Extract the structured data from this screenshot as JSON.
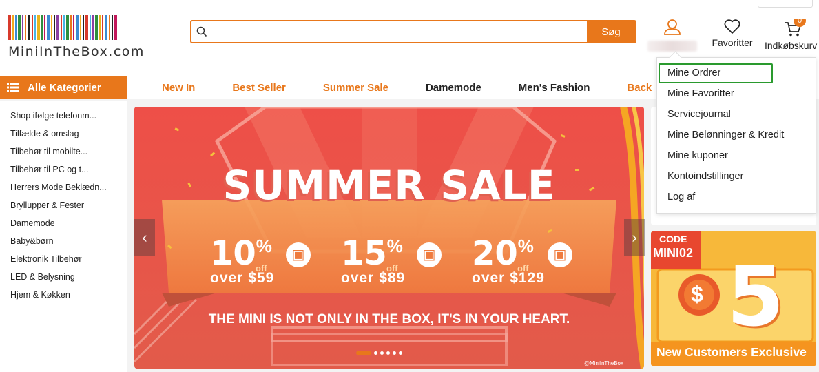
{
  "logo": {
    "text": "MiniInTheBox.com",
    "bar_colors": [
      "#d83a2c",
      "#f2a81d",
      "#3b8bd2",
      "#2e8e3e",
      "#8b3fa4",
      "#e8771b",
      "#222",
      "#d83a2c",
      "#47b3e3",
      "#e8b41b",
      "#2e8e3e",
      "#c2185b",
      "#3b8bd2",
      "#f2a81d",
      "#222",
      "#8b3fa4",
      "#d83a2c",
      "#47b3e3",
      "#2e8e3e",
      "#e8771b",
      "#c2185b",
      "#3b8bd2",
      "#f2a81d",
      "#222",
      "#d83a2c",
      "#47b3e3",
      "#8b3fa4",
      "#2e8e3e",
      "#e8b41b",
      "#d83a2c",
      "#3b8bd2",
      "#e8771b",
      "#222",
      "#c2185b"
    ]
  },
  "search": {
    "value": "",
    "button": "Søg"
  },
  "header": {
    "favorites": "Favoritter",
    "cart": "Indkøbskurv",
    "cart_count": "0"
  },
  "nav": {
    "all_categories": "Alle Kategorier",
    "links": [
      {
        "label": "New In",
        "color": "#e8771b"
      },
      {
        "label": "Best Seller",
        "color": "#e8771b"
      },
      {
        "label": "Summer Sale",
        "color": "#e8771b"
      },
      {
        "label": "Damemode",
        "color": "#222222"
      },
      {
        "label": "Men's Fashion",
        "color": "#222222"
      },
      {
        "label": "Back To",
        "color": "#e8771b"
      }
    ]
  },
  "sidebar": [
    "Shop ifølge telefonm...",
    "Tilfælde & omslag",
    "Tilbehør til mobilte...",
    "Tilbehør til PC og t...",
    "Herrers Mode Beklædn...",
    "Bryllupper & Fester",
    "Damemode",
    "Baby&børn",
    "Elektronik Tilbehør",
    "LED & Belysning",
    "Hjem & Køkken"
  ],
  "dropdown": [
    "Mine Ordrer",
    "Mine Favoritter",
    "Servicejournal",
    "Mine Belønninger & Kredit",
    "Mine kuponer",
    "Kontoindstillinger",
    "Log af"
  ],
  "banner": {
    "title": "SUMMER SALE",
    "offers": [
      {
        "pct": "10",
        "off": "off",
        "over": "over $59"
      },
      {
        "pct": "15",
        "off": "off",
        "over": "over $89"
      },
      {
        "pct": "20",
        "off": "off",
        "over": "over $129"
      }
    ],
    "tagline": "THE MINI IS NOT ONLY IN THE BOX, IT'S IN YOUR HEART.",
    "watermark": "@MiniInTheBox",
    "slides": 6,
    "active_slide": 0
  },
  "promo": {
    "code_label": "CODE",
    "code": "MINI02",
    "currency": "$",
    "amount": "5",
    "caption": "New Customers Exclusive"
  },
  "colors": {
    "accent": "#e8771b",
    "highlight": "#2a9a2e",
    "banner_red": "#e85445"
  }
}
